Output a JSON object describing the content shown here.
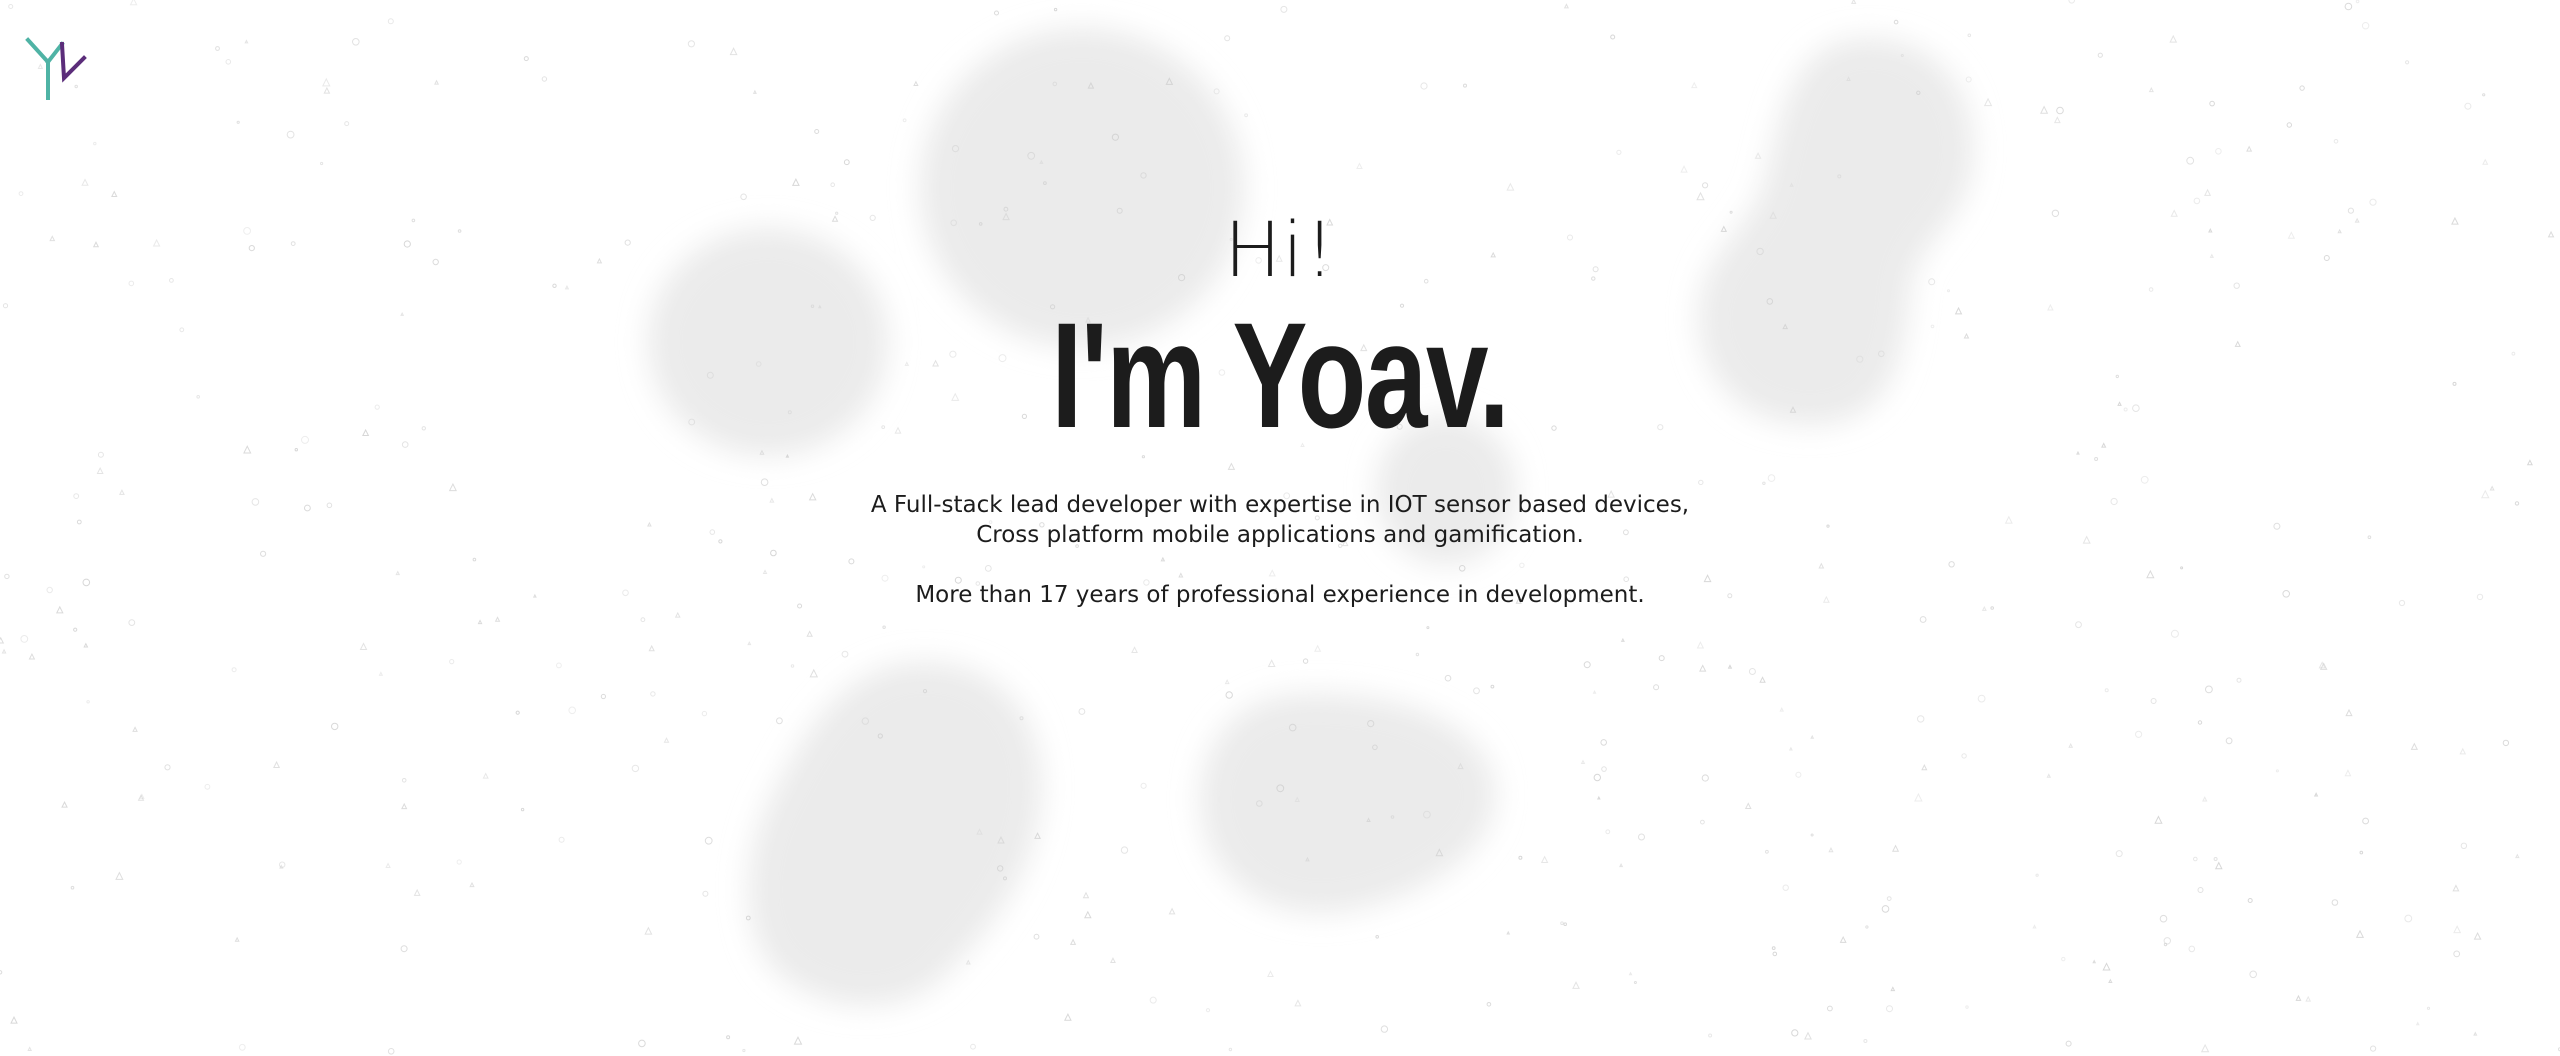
{
  "logo": {
    "name": "YL monogram",
    "colors": {
      "teal": "#4fb3a5",
      "purple": "#5b2d7a"
    }
  },
  "hero": {
    "greeting": "Hi!",
    "name": "I'm Yoav.",
    "description_line1": "A Full-stack lead developer with expertise in IOT sensor based devices,",
    "description_line2": "Cross platform mobile applications and gamification.",
    "experience": "More than 17 years of professional experience in development."
  },
  "theme": {
    "background": "#ffffff",
    "blob_color": "#e6e6e6",
    "speck_color": "#cfcfcf",
    "text_color": "#1c1c1c"
  }
}
